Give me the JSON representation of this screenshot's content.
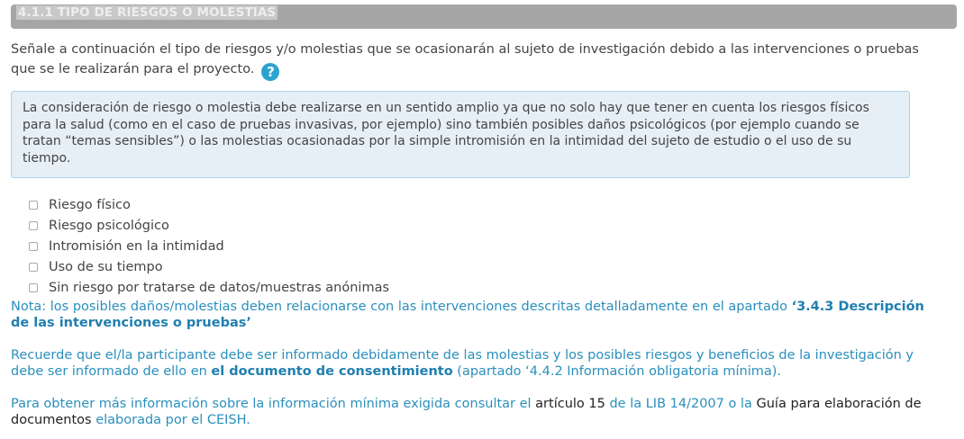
{
  "section": {
    "title": "4.1.1 TIPO DE RIESGOS O MOLESTIAS"
  },
  "intro": {
    "text": "Señale a continuación el tipo de riesgos y/o molestias que se ocasionarán al sujeto de investigación debido a las intervenciones o pruebas que se le realizarán para el proyecto.",
    "help_icon": "?"
  },
  "info_box": {
    "text": "La consideración de riesgo o molestia debe realizarse en un sentido amplio ya que no solo hay que tener en cuenta los riesgos físicos para la salud (como en el caso de pruebas invasivas, por ejemplo) sino también posibles daños psicológicos (por ejemplo cuando se tratan “temas sensibles”) o las molestias ocasionadas por la simple intromisión en la intimidad del sujeto de estudio o el uso de su tiempo."
  },
  "options": [
    {
      "label": "Riesgo físico",
      "checked": false
    },
    {
      "label": "Riesgo psicológico",
      "checked": false
    },
    {
      "label": "Intromisión en la intimidad",
      "checked": false
    },
    {
      "label": "Uso de su tiempo",
      "checked": false
    },
    {
      "label": "Sin riesgo por tratarse de datos/muestras anónimas",
      "checked": false
    }
  ],
  "note1": {
    "prefix": "Nota: los posibles daños/molestias deben relacionarse con las intervenciones descritas detalladamente en el apartado ",
    "strong": "‘3.4.3 Descripción de las intervenciones o pruebas’"
  },
  "note2": {
    "prefix": "Recuerde que el/la participante debe ser informado debidamente de las molestias y los posibles riesgos y beneficios de la investigación y debe ser informado de ello en ",
    "strong": "el documento de consentimiento",
    "suffix": " (apartado ‘4.4.2 Información obligatoria mínima)."
  },
  "note3": {
    "part1": "Para obtener más información sobre la información mínima exigida consultar el ",
    "link1": "artículo 15",
    "part2": " de la LIB 14/2007 o la ",
    "link2": "Guía para elaboración de documentos",
    "part3": " elaborada por el CEISH."
  },
  "colors": {
    "header_bg": "#a6a6a6",
    "info_bg": "#e6eff6",
    "info_border": "#a9d3ea",
    "note_text": "#2a8fbd",
    "help_icon": "#2ba3cf"
  }
}
